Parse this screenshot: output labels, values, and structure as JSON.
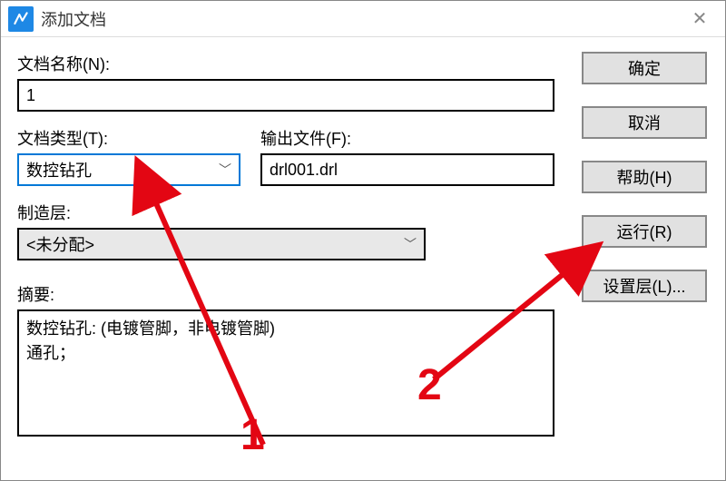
{
  "window": {
    "title": "添加文档"
  },
  "form": {
    "docNameLabel": "文档名称(N):",
    "docNameValue": "1",
    "docTypeLabel": "文档类型(T):",
    "docTypeValue": "数控钻孔",
    "outputFileLabel": "输出文件(F):",
    "outputFileValue": "drl001.drl",
    "fabLayerLabel": "制造层:",
    "fabLayerValue": "<未分配>",
    "summaryLabel": "摘要:",
    "summaryValue": "数控钻孔: (电镀管脚，非电镀管脚)\n通孔；"
  },
  "buttons": {
    "ok": "确定",
    "cancel": "取消",
    "help": "帮助(H)",
    "run": "运行(R)",
    "setLayers": "设置层(L)..."
  },
  "annotations": {
    "one": "1",
    "two": "2"
  }
}
